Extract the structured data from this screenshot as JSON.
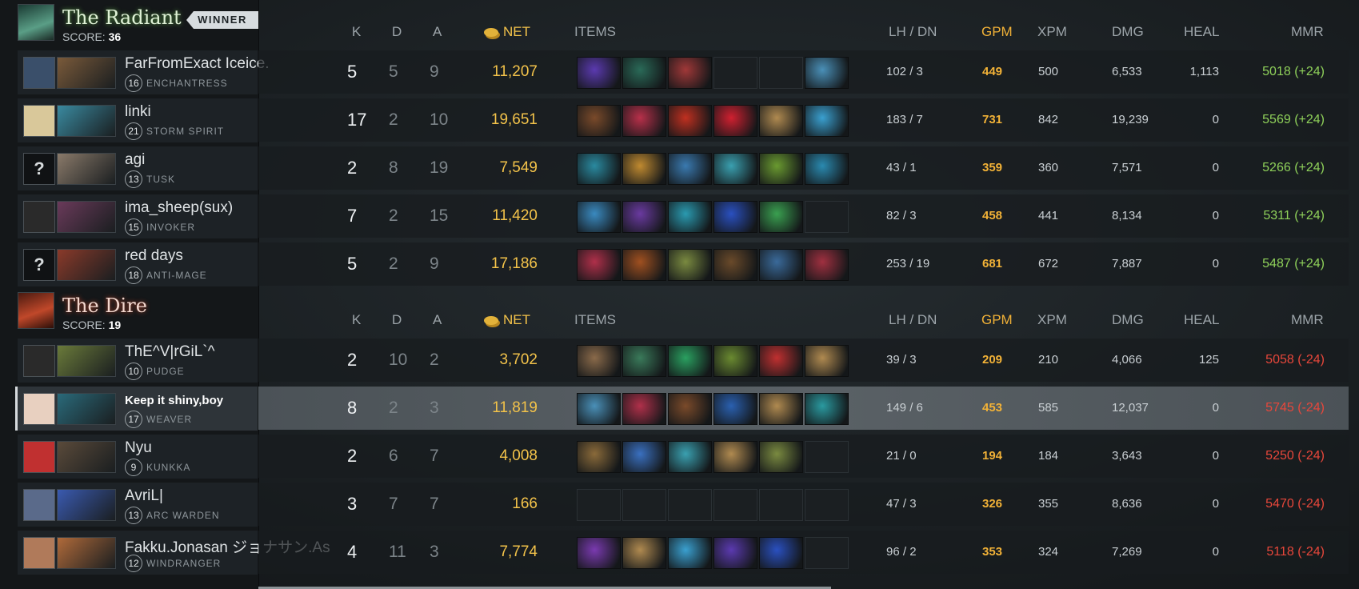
{
  "columns": {
    "k": "K",
    "d": "D",
    "a": "A",
    "net": "NET",
    "items": "ITEMS",
    "lh_dn": "LH / DN",
    "gpm": "GPM",
    "xpm": "XPM",
    "dmg": "DMG",
    "heal": "HEAL",
    "mmr": "MMR"
  },
  "colors": {
    "gold": "#f2c24a",
    "gpm": "#f2b237",
    "mmr_up": "#8fd15a",
    "mmr_down": "#e8473b"
  },
  "radiant": {
    "name": "The Radiant",
    "score_label": "SCORE:",
    "score": "36",
    "winner_badge": "WINNER",
    "players": [
      {
        "name": "FarFromExact Iceice.",
        "level": "16",
        "hero": "ENCHANTRESS",
        "avatar": "team-logo",
        "k": "5",
        "d": "5",
        "a": "9",
        "net": "11,207",
        "lh": "102",
        "dn": "3",
        "gpm": "449",
        "xpm": "500",
        "dmg": "6,533",
        "heal": "1,113",
        "mmr": "5018 (+24)",
        "items": [
          "#5b3ab0",
          "#2a6a58",
          "#a03838",
          "",
          "",
          "#4a90b8"
        ]
      },
      {
        "name": "linki",
        "level": "21",
        "hero": "STORM SPIRIT",
        "avatar": "cartoon",
        "k": "17",
        "d": "2",
        "a": "10",
        "net": "19,651",
        "lh": "183",
        "dn": "7",
        "gpm": "731",
        "xpm": "842",
        "dmg": "19,239",
        "heal": "0",
        "mmr": "5569 (+24)",
        "items": [
          "#7a4a2a",
          "#b8304a",
          "#c03020",
          "#d02030",
          "#b08a50",
          "#3aa0d0"
        ]
      },
      {
        "name": "agi",
        "level": "13",
        "hero": "TUSK",
        "avatar": "?",
        "k": "2",
        "d": "8",
        "a": "19",
        "net": "7,549",
        "lh": "43",
        "dn": "1",
        "gpm": "359",
        "xpm": "360",
        "dmg": "7,571",
        "heal": "0",
        "mmr": "5266 (+24)",
        "items": [
          "#2a8aa0",
          "#c08a30",
          "#3a7ab0",
          "#3aa0b0",
          "#6a9a30",
          "#2a8ab0"
        ]
      },
      {
        "name": "ima_sheep(sux)",
        "level": "15",
        "hero": "INVOKER",
        "avatar": "cartoon2",
        "k": "7",
        "d": "2",
        "a": "15",
        "net": "11,420",
        "lh": "82",
        "dn": "3",
        "gpm": "458",
        "xpm": "441",
        "dmg": "8,134",
        "heal": "0",
        "mmr": "5311 (+24)",
        "items": [
          "#3a8ac0",
          "#6a3aa0",
          "#2a9ab0",
          "#2a50c0",
          "#3aa050",
          ""
        ]
      },
      {
        "name": "red days",
        "level": "18",
        "hero": "ANTI-MAGE",
        "avatar": "?",
        "k": "5",
        "d": "2",
        "a": "9",
        "net": "17,186",
        "lh": "253",
        "dn": "19",
        "gpm": "681",
        "xpm": "672",
        "dmg": "7,887",
        "heal": "0",
        "mmr": "5487 (+24)",
        "items": [
          "#b0304a",
          "#a05020",
          "#7a8a40",
          "#6a4a2a",
          "#3a6a9a",
          "#a03040"
        ]
      }
    ]
  },
  "dire": {
    "name": "The Dire",
    "score_label": "SCORE:",
    "score": "19",
    "players": [
      {
        "name": "ThE^V|rGiL`^",
        "level": "10",
        "hero": "PUDGE",
        "avatar": "silhouette",
        "k": "2",
        "d": "10",
        "a": "2",
        "net": "3,702",
        "lh": "39",
        "dn": "3",
        "gpm": "209",
        "xpm": "210",
        "dmg": "4,066",
        "heal": "125",
        "mmr": "5058 (-24)",
        "items": [
          "#8a6a4a",
          "#3a7a5a",
          "#2aa060",
          "#6a8a30",
          "#c03030",
          "#b08a50"
        ]
      },
      {
        "name": "Keep it shiny,boy",
        "level": "17",
        "hero": "WEAVER",
        "avatar": "girl",
        "k": "8",
        "d": "2",
        "a": "3",
        "net": "11,819",
        "lh": "149",
        "dn": "6",
        "gpm": "453",
        "xpm": "585",
        "dmg": "12,037",
        "heal": "0",
        "mmr": "5745 (-24)",
        "items": [
          "#4a90b8",
          "#b0304a",
          "#7a4a2a",
          "#2a60b0",
          "#b08a50",
          "#2a9aa0"
        ]
      },
      {
        "name": "Nyu",
        "level": "9",
        "hero": "KUNKKA",
        "avatar": "anime",
        "k": "2",
        "d": "6",
        "a": "7",
        "net": "4,008",
        "lh": "21",
        "dn": "0",
        "gpm": "194",
        "xpm": "184",
        "dmg": "3,643",
        "heal": "0",
        "mmr": "5250 (-24)",
        "items": [
          "#8a6a3a",
          "#3a70c0",
          "#3aa0b0",
          "#b08a50",
          "#7a8a40",
          ""
        ]
      },
      {
        "name": "AvriL|",
        "level": "13",
        "hero": "ARC WARDEN",
        "avatar": "dark",
        "k": "3",
        "d": "7",
        "a": "7",
        "net": "166",
        "lh": "47",
        "dn": "3",
        "gpm": "326",
        "xpm": "355",
        "dmg": "8,636",
        "heal": "0",
        "mmr": "5470 (-24)",
        "items": [
          "",
          "",
          "",
          "",
          "",
          ""
        ]
      },
      {
        "name": "Fakku.Jonasan ジョナサン.As",
        "level": "12",
        "hero": "WINDRANGER",
        "avatar": "girl2",
        "k": "4",
        "d": "11",
        "a": "3",
        "net": "7,774",
        "lh": "96",
        "dn": "2",
        "gpm": "353",
        "xpm": "324",
        "dmg": "7,269",
        "heal": "0",
        "mmr": "5118 (-24)",
        "items": [
          "#7a3ab0",
          "#b08a50",
          "#3aa0d0",
          "#5b3ab0",
          "#2a50c0",
          ""
        ]
      }
    ]
  }
}
